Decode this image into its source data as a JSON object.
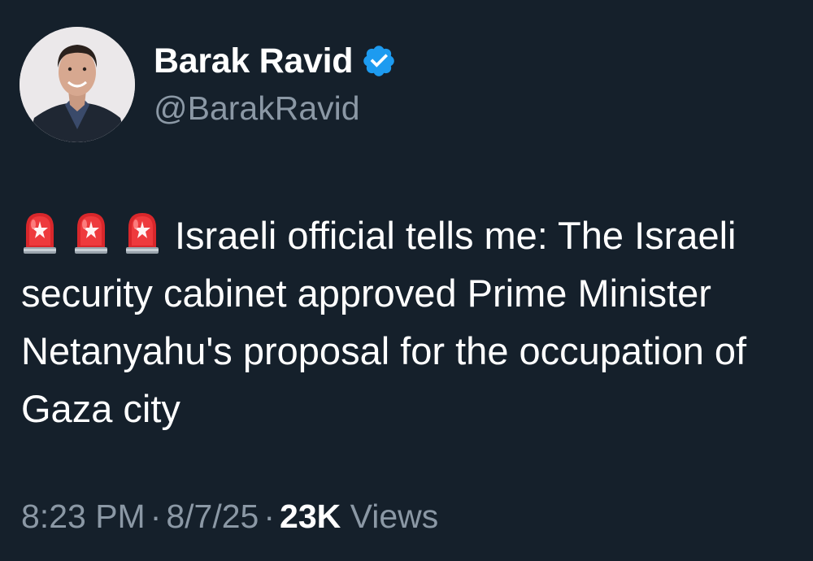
{
  "author": {
    "display_name": "Barak Ravid",
    "handle": "@BarakRavid",
    "verified": true,
    "avatar_icon": "person-avatar-icon",
    "verified_icon": "verified-badge-icon",
    "verified_color": "#1d9bf0"
  },
  "tweet": {
    "emoji_icons": [
      "police-siren-icon",
      "police-siren-icon",
      "police-siren-icon"
    ],
    "text": "Israeli official tells me: The Israeli security cabinet approved Prime Minister Netanyahu's proposal for the occupation of Gaza city"
  },
  "meta": {
    "time": "8:23 PM",
    "separator": "·",
    "date": "8/7/25",
    "views_count": "23K",
    "views_label": "Views"
  },
  "colors": {
    "background": "#15202b",
    "primary_text": "#ffffff",
    "secondary_text": "#8b98a5"
  }
}
